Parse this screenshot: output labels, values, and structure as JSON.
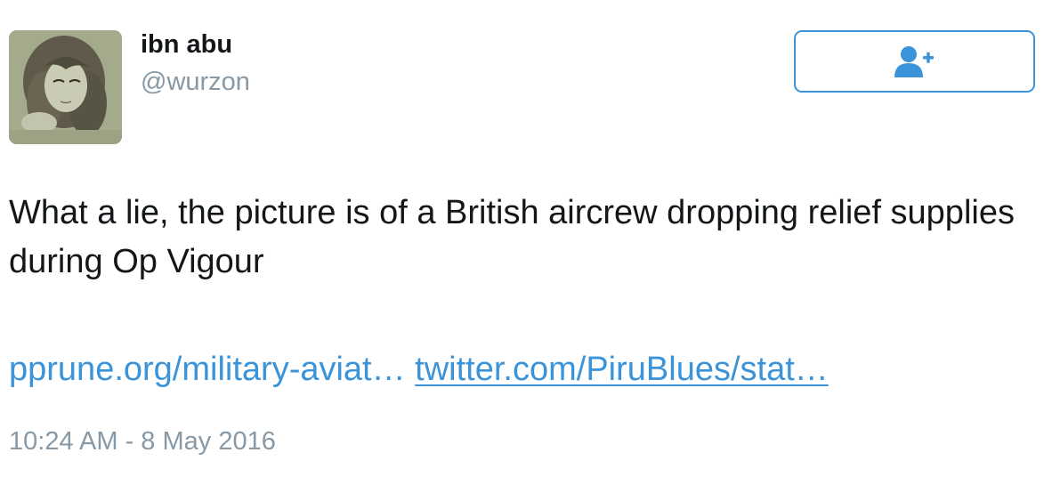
{
  "user": {
    "display_name": "ibn abu",
    "handle": "@wurzon"
  },
  "follow_button": {
    "icon": "add-user-icon",
    "color": "#3b94d9"
  },
  "tweet": {
    "text": "What a lie, the picture is of a British aircrew dropping relief supplies during Op Vigour",
    "links": [
      {
        "text": "pprune.org/military-aviat…"
      },
      {
        "text": "twitter.com/PiruBlues/stat…"
      }
    ],
    "timestamp": "10:24 AM - 8 May 2016"
  },
  "colors": {
    "text": "#14171a",
    "secondary": "#8899a6",
    "link": "#3b94d9"
  }
}
